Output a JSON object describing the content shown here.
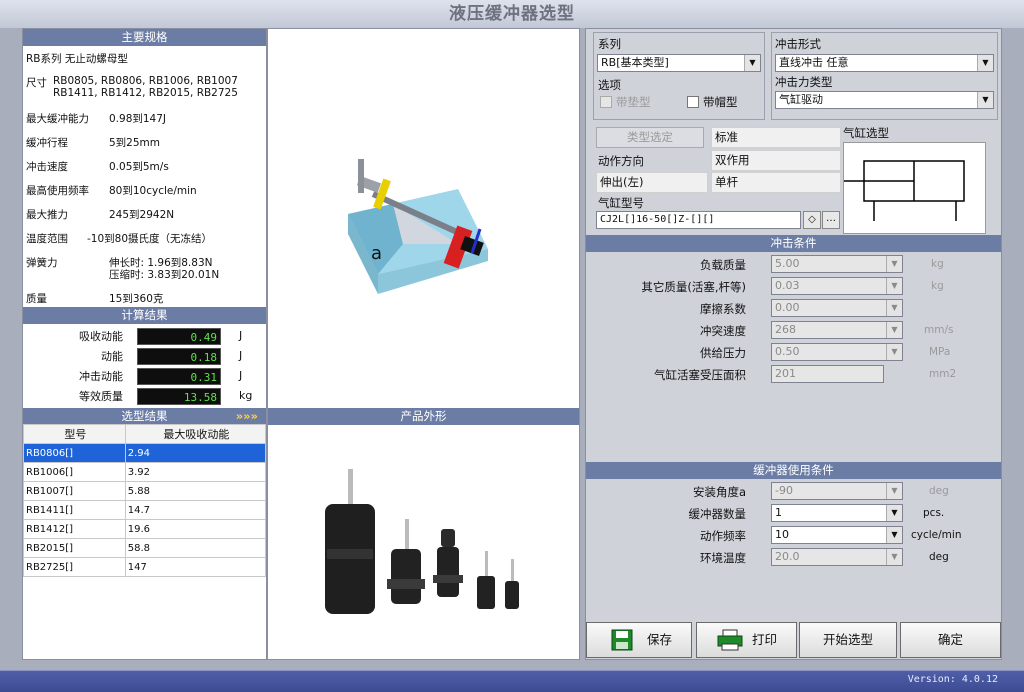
{
  "window_title": "液压缓冲器选型",
  "version": "Version: 4.0.12",
  "specs": {
    "header": "主要规格",
    "series": "RB系列  无止动螺母型",
    "size_label": "尺寸",
    "size_line1": "RB0805, RB0806, RB1006, RB1007",
    "size_line2": "RB1411, RB1412, RB2015, RB2725",
    "rows": [
      {
        "label": "最大缓冲能力",
        "value": "0.98到147J"
      },
      {
        "label": "缓冲行程",
        "value": "5到25mm"
      },
      {
        "label": "冲击速度",
        "value": "0.05到5m/s"
      },
      {
        "label": "最高使用频率",
        "value": "80到10cycle/min"
      },
      {
        "label": "最大推力",
        "value": "245到2942N"
      },
      {
        "label": "温度范围",
        "value": "-10到80摄氏度（无冻结）"
      }
    ],
    "spring_label": "弹簧力",
    "spring_ext": "伸长时: 1.96到8.83N",
    "spring_comp": "压缩时: 3.83到20.01N",
    "mass_label": "质量",
    "mass_value": "15到360克"
  },
  "calc": {
    "header": "计算结果",
    "rows": [
      {
        "label": "吸收动能",
        "value": "0.49",
        "unit": "J"
      },
      {
        "label": "动能",
        "value": "0.18",
        "unit": "J"
      },
      {
        "label": "冲击动能",
        "value": "0.31",
        "unit": "J"
      },
      {
        "label": "等效质量",
        "value": "13.58",
        "unit": "kg"
      }
    ]
  },
  "results": {
    "header": "选型结果",
    "arrows": "»»»",
    "col_model": "型号",
    "col_energy": "最大吸收动能",
    "rows": [
      {
        "model": "RB0806[]",
        "energy": "2.94"
      },
      {
        "model": "RB1006[]",
        "energy": "3.92"
      },
      {
        "model": "RB1007[]",
        "energy": "5.88"
      },
      {
        "model": "RB1411[]",
        "energy": "14.7"
      },
      {
        "model": "RB1412[]",
        "energy": "19.6"
      },
      {
        "model": "RB2015[]",
        "energy": "58.8"
      },
      {
        "model": "RB2725[]",
        "energy": "147"
      }
    ]
  },
  "diagram": {
    "marker": "a"
  },
  "product": {
    "header": "产品外形"
  },
  "right": {
    "series_label": "系列",
    "series_value": "RB[基本类型]",
    "options_label": "选项",
    "opt_pad": "带垫型",
    "opt_cap": "带帽型",
    "impact_form_label": "冲击形式",
    "impact_form_value": "直线冲击  任意",
    "impact_force_label": "冲击力类型",
    "impact_force_value": "气缸驱动",
    "type_select_btn": "类型选定",
    "type_value": "标准",
    "action_dir_label": "动作方向",
    "action_dir_value": "双作用",
    "extend_label": "伸出(左)",
    "rod_value": "单杆",
    "cyl_model_label": "气缸型号",
    "cyl_model_value": "CJ2L[]16-50[]Z-[][]",
    "cyl_select_label": "气缸选型",
    "impact_header": "冲击条件",
    "impact_rows": [
      {
        "label": "负载质量",
        "value": "5.00",
        "unit": "kg"
      },
      {
        "label": "其它质量(活塞,杆等)",
        "value": "0.03",
        "unit": "kg"
      },
      {
        "label": "摩擦系数",
        "value": "0.00",
        "unit": ""
      },
      {
        "label": "冲突速度",
        "value": "268",
        "unit": "mm/s"
      },
      {
        "label": "供给压力",
        "value": "0.50",
        "unit": "MPa"
      },
      {
        "label": "气缸活塞受压面积",
        "value": "201",
        "unit": "mm2"
      }
    ],
    "use_header": "缓冲器使用条件",
    "use_rows": [
      {
        "label": "安装角度a",
        "value": "-90",
        "unit": "deg"
      },
      {
        "label": "缓冲器数量",
        "value": "1",
        "unit": "pcs."
      },
      {
        "label": "动作频率",
        "value": "10",
        "unit": "cycle/min"
      },
      {
        "label": "环境温度",
        "value": "20.0",
        "unit": "deg"
      }
    ]
  },
  "buttons": {
    "save": "保存",
    "print": "打印",
    "start": "开始选型",
    "ok": "确定"
  }
}
